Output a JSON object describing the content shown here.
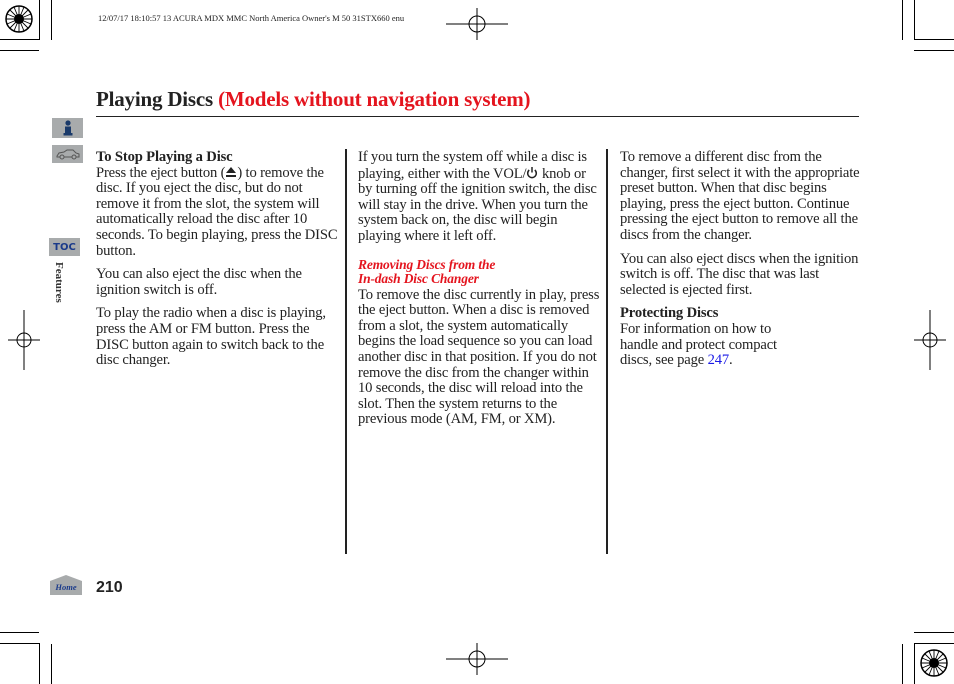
{
  "header": {
    "slug": "12/07/17 18:10:57   13 ACURA MDX MMC North America Owner's M 50 31STX660 enu"
  },
  "page": {
    "title_main": "Playing Discs",
    "title_qualifier": "(Models without navigation system)",
    "number": "210",
    "section_label": "Features"
  },
  "sidebar": {
    "info_icon": "info-icon",
    "car_icon": "car-icon",
    "toc_label": "TOC",
    "home_label": "Home"
  },
  "columns": {
    "col1": {
      "heading": "To Stop Playing a Disc",
      "p1_before": "Press the eject button (",
      "p1_after": ") to remove the disc. If you eject the disc, but do not remove it from the slot, the system will automatically reload the disc after 10 seconds. To begin playing, press the DISC button.",
      "p2": "You can also eject the disc when the ignition switch is off.",
      "p3": "To play the radio when a disc is playing, press the AM or FM button. Press the DISC button again to switch back to the disc changer."
    },
    "col2": {
      "p1_before": "If you turn the system off while a disc is playing, either with the VOL/",
      "p1_after": " knob or by turning off the ignition switch, the disc will stay in the drive. When you turn the system back on, the disc will begin playing where it left off.",
      "subheading_line1": "Removing Discs from the",
      "subheading_line2": "In-dash Disc Changer",
      "p2": "To remove the disc currently in play, press the eject button. When a disc is removed from a slot, the system automatically begins the load sequence so you can load another disc in that position. If you do not remove the disc from the changer within 10 seconds, the disc will reload into the slot. Then the system returns to the previous mode (AM, FM, or XM)."
    },
    "col3": {
      "p1": "To remove a different disc from the changer, first select it with the appropriate preset button. When that disc begins playing, press the eject button. Continue pressing the eject button to remove all the discs from the changer.",
      "p2": "You can also eject discs when the ignition switch is off. The disc that was last selected is ejected first.",
      "heading": "Protecting Discs",
      "p3_line1": "For information on how to",
      "p3_line2": "handle and protect compact",
      "p3_line3": "discs, see page ",
      "p3_link": "247",
      "p3_end": "."
    }
  },
  "colors": {
    "accent_red": "#e4141e",
    "link_blue": "#1a1ae6",
    "sidebar_gray": "#a8abac",
    "toc_blue": "#1a3a8a"
  }
}
